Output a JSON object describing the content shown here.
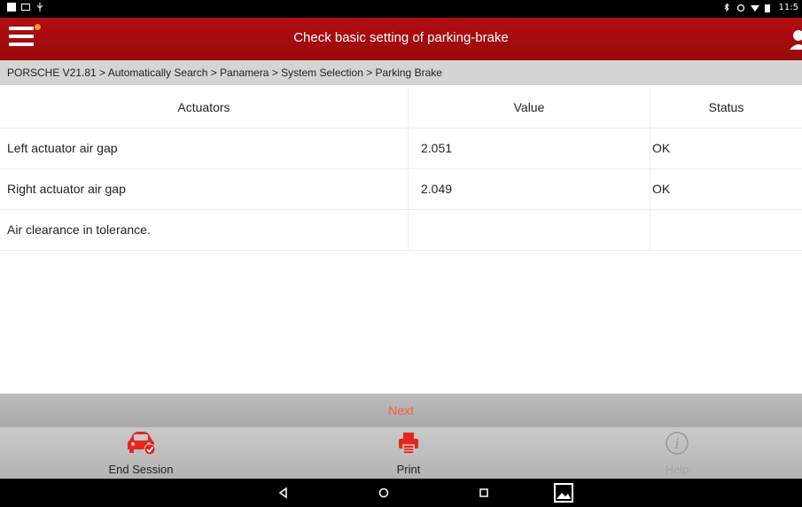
{
  "status_bar": {
    "time": "11:5"
  },
  "app_bar": {
    "title": "Check basic setting of parking-brake"
  },
  "breadcrumb": {
    "text": "PORSCHE V21.81 > Automatically Search > Panamera > System Selection > Parking Brake"
  },
  "table": {
    "headers": [
      "Actuators",
      "Value",
      "Status"
    ],
    "rows": [
      {
        "actuator": "Left actuator air gap",
        "value": "2.051",
        "status": "OK"
      },
      {
        "actuator": "Right actuator air gap",
        "value": "2.049",
        "status": "OK"
      },
      {
        "actuator": "Air clearance in tolerance.",
        "value": "",
        "status": ""
      }
    ]
  },
  "next_button": {
    "label": "Next",
    "color": "#ff5a45"
  },
  "toolbar": {
    "items": [
      {
        "label": "End Session",
        "icon": "car-check-icon"
      },
      {
        "label": "Print",
        "icon": "printer-icon"
      },
      {
        "label": "Help",
        "icon": "info-icon"
      }
    ]
  },
  "colors": {
    "accent": "#b00e12",
    "toolbar_icon": "#e8251c"
  }
}
